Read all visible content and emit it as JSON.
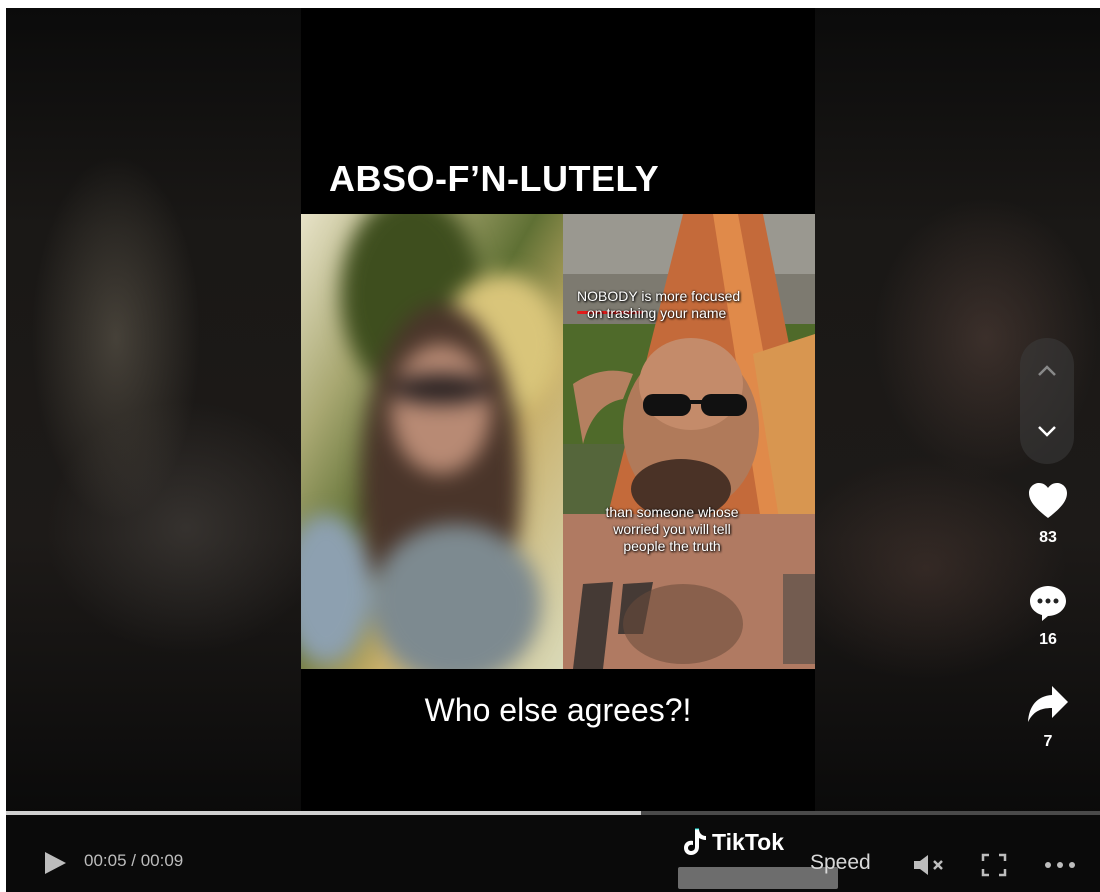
{
  "video": {
    "title_text": "ABSO-F’N-LUTELY",
    "caption_text": "Who else agrees?!",
    "overlay_top_bold": "NOBODY",
    "overlay_top_rest": " is more focused",
    "overlay_top_line2": "on trashing your name",
    "overlay_bottom_line1": "than someone whose",
    "overlay_bottom_line2": "worried you will tell",
    "overlay_bottom_line3": "people the truth"
  },
  "actions": {
    "likes": "83",
    "comments": "16",
    "shares": "7"
  },
  "player": {
    "time": "00:05 / 00:09",
    "progress": 0.58,
    "brand": "TikTok",
    "speed_label": "Speed"
  },
  "colors": {
    "underline": "#e21b1b",
    "background": "#0b0b0b"
  },
  "icons": [
    "chevron-up-icon",
    "chevron-down-icon",
    "heart-icon",
    "comment-icon",
    "share-icon",
    "play-icon",
    "tiktok-logo-icon",
    "volume-muted-icon",
    "fullscreen-icon",
    "more-icon"
  ]
}
